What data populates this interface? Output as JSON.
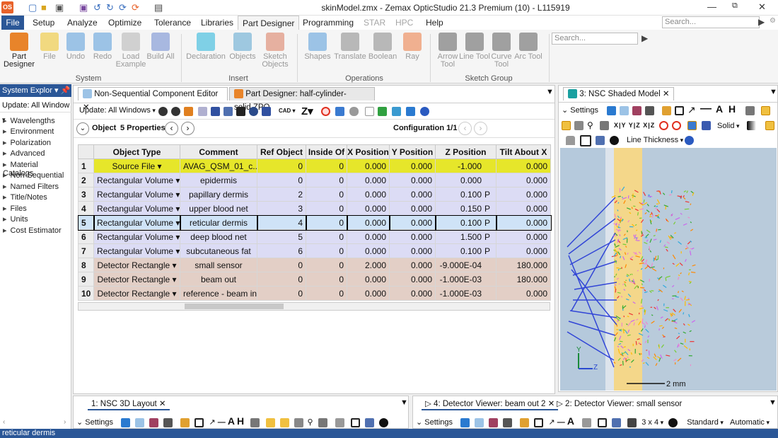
{
  "window": {
    "title": "skinModel.zmx - Zemax OpticStudio 21.3   Premium (10) - L115919",
    "app_icon": "OS"
  },
  "menu": {
    "tabs": [
      "File",
      "Setup",
      "Analyze",
      "Optimize",
      "Tolerance",
      "Libraries",
      "Part Designer",
      "Programming",
      "STAR",
      "HPC",
      "Help"
    ],
    "search_placeholder": "Search..."
  },
  "ribbon": {
    "buttons": [
      {
        "label": "Part Designer",
        "enabled": true,
        "color": "#e8842a"
      },
      {
        "label": "File",
        "enabled": false,
        "color": "#f1d980"
      },
      {
        "label": "Undo",
        "enabled": false,
        "color": "#9cc3e6"
      },
      {
        "label": "Redo",
        "enabled": false,
        "color": "#9cc3e6"
      },
      {
        "label": "Load Example",
        "enabled": false,
        "color": "#cccccc"
      },
      {
        "label": "Build All",
        "enabled": false,
        "color": "#a8b8e0"
      },
      {
        "label": "Declaration",
        "enabled": false,
        "color": "#7fd0e6"
      },
      {
        "label": "Objects",
        "enabled": false,
        "color": "#9ec8e0"
      },
      {
        "label": "Sketch Objects",
        "enabled": false,
        "color": "#e6b0a0"
      },
      {
        "label": "Shapes",
        "enabled": false,
        "color": "#9cc3e6"
      },
      {
        "label": "Translate",
        "enabled": false,
        "color": "#b8b8b8"
      },
      {
        "label": "Boolean",
        "enabled": false,
        "color": "#b8b8b8"
      },
      {
        "label": "Ray",
        "enabled": false,
        "color": "#f0b090"
      },
      {
        "label": "Arrow Tool",
        "enabled": false,
        "color": "#a0a0a0"
      },
      {
        "label": "Line Tool",
        "enabled": false,
        "color": "#a0a0a0"
      },
      {
        "label": "Curve Tool",
        "enabled": false,
        "color": "#a0a0a0"
      },
      {
        "label": "Arc Tool",
        "enabled": false,
        "color": "#a0a0a0"
      }
    ],
    "groups": [
      "System",
      "Insert",
      "Operations",
      "Sketch Group"
    ],
    "search_placeholder": "Search..."
  },
  "left_panel": {
    "title": "System Explor",
    "update": "Update: All Window",
    "items": [
      "Wavelengths",
      "Environment",
      "Polarization",
      "Advanced",
      "Material Catalogs",
      "Non-Sequential",
      "Named Filters",
      "Title/Notes",
      "Files",
      "Units",
      "Cost Estimator"
    ]
  },
  "editor": {
    "tabs": [
      "Non-Sequential Component Editor",
      "Part Designer: half-cylinder-solid.ZPO"
    ],
    "update": "Update: All Windows",
    "object_label": "Object",
    "properties": "5 Properties",
    "configuration": "Configuration 1/1",
    "columns": [
      "Object Type",
      "Comment",
      "Ref Object",
      "Inside Of",
      "X Position",
      "Y Position",
      "Z Position",
      "Tilt About X"
    ],
    "rows": [
      {
        "n": "1",
        "type": "Source File",
        "comment": "AVAG_QSM_01_c...",
        "ref": "0",
        "inside": "0",
        "x": "0.000",
        "y": "0.000",
        "z": "-1.000",
        "zflag": "",
        "tilt": "0.000",
        "color": "#e6e62a"
      },
      {
        "n": "2",
        "type": "Rectangular Volume",
        "comment": "epidermis",
        "ref": "0",
        "inside": "0",
        "x": "0.000",
        "y": "0.000",
        "z": "0.000",
        "zflag": "",
        "tilt": "0.000",
        "color": "#dcdcf5"
      },
      {
        "n": "3",
        "type": "Rectangular Volume",
        "comment": "papillary dermis",
        "ref": "2",
        "inside": "0",
        "x": "0.000",
        "y": "0.000",
        "z": "0.100",
        "zflag": "P",
        "tilt": "0.000",
        "color": "#dcdcf5"
      },
      {
        "n": "4",
        "type": "Rectangular Volume",
        "comment": "upper blood net",
        "ref": "3",
        "inside": "0",
        "x": "0.000",
        "y": "0.000",
        "z": "0.150",
        "zflag": "P",
        "tilt": "0.000",
        "color": "#dcdcf5"
      },
      {
        "n": "5",
        "type": "Rectangular Volume",
        "comment": "reticular dermis",
        "ref": "4",
        "inside": "0",
        "x": "0.000",
        "y": "0.000",
        "z": "0.100",
        "zflag": "P",
        "tilt": "0.000",
        "color": "#cfe3f7"
      },
      {
        "n": "6",
        "type": "Rectangular Volume",
        "comment": "deep blood net",
        "ref": "5",
        "inside": "0",
        "x": "0.000",
        "y": "0.000",
        "z": "1.500",
        "zflag": "P",
        "tilt": "0.000",
        "color": "#dcdcf5"
      },
      {
        "n": "7",
        "type": "Rectangular Volume",
        "comment": "subcutaneous fat",
        "ref": "6",
        "inside": "0",
        "x": "0.000",
        "y": "0.000",
        "z": "0.100",
        "zflag": "P",
        "tilt": "0.000",
        "color": "#dcdcf5"
      },
      {
        "n": "8",
        "type": "Detector Rectangle",
        "comment": "small sensor",
        "ref": "0",
        "inside": "0",
        "x": "2.000",
        "y": "0.000",
        "z": "-9.000E-04",
        "zflag": "",
        "tilt": "180.000",
        "color": "#e3cfc6"
      },
      {
        "n": "9",
        "type": "Detector Rectangle",
        "comment": "beam out",
        "ref": "0",
        "inside": "0",
        "x": "0.000",
        "y": "0.000",
        "z": "-1.000E-03",
        "zflag": "",
        "tilt": "180.000",
        "color": "#e3cfc6"
      },
      {
        "n": "10",
        "type": "Detector Rectangle",
        "comment": "reference - beam in",
        "ref": "0",
        "inside": "0",
        "x": "0.000",
        "y": "0.000",
        "z": "-1.000E-03",
        "zflag": "",
        "tilt": "0.000",
        "color": "#e3cfc6"
      }
    ]
  },
  "viewer": {
    "tab": "3: NSC Shaded Model",
    "settings": "Settings",
    "solid": "Solid",
    "line_thickness": "Line Thickness",
    "scale": "2 mm",
    "axis_y": "Y",
    "axis_z": "Z",
    "axis_buttons": "X|Y Y|Z X|Z"
  },
  "bottom": {
    "layout_tab": "1: NSC 3D Layout",
    "settings": "Settings",
    "det1_tab": "4: Detector Viewer: beam out 2",
    "det2_tab": "2: Detector Viewer: small sensor",
    "grid_label": "3 x 4",
    "standard": "Standard",
    "automatic": "Automatic"
  },
  "status": {
    "text": "reticular dermis"
  }
}
